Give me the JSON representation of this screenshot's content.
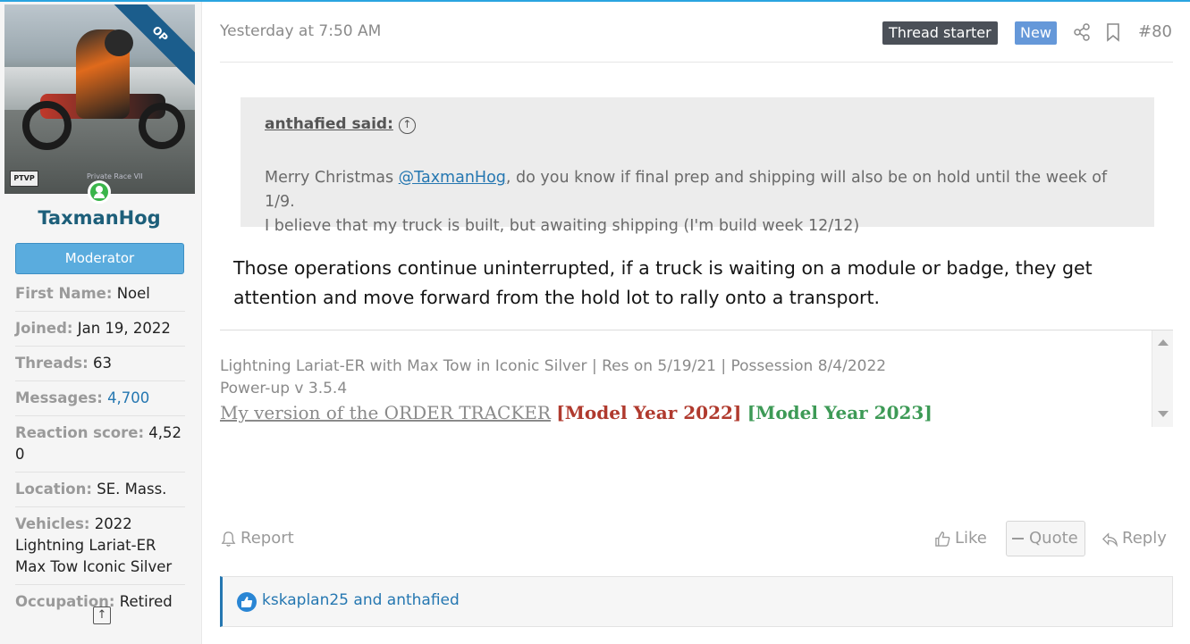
{
  "sidebar": {
    "op_label": "OP",
    "avatar_logo": "PTVP",
    "avatar_watermark": "Private Race VII",
    "username": "TaxmanHog",
    "role": "Moderator",
    "fields": [
      {
        "label": "First Name:",
        "value": "Noel"
      },
      {
        "label": "Joined:",
        "value": "Jan 19, 2022"
      },
      {
        "label": "Threads:",
        "value": "63"
      },
      {
        "label": "Messages:",
        "value": "4,700"
      },
      {
        "label": "Reaction score:",
        "value": "4,520"
      },
      {
        "label": "Location:",
        "value": "SE. Mass."
      },
      {
        "label": "Vehicles:",
        "value": "2022 Lightning Lariat-ER Max Tow Iconic Silver"
      },
      {
        "label": "Occupation:",
        "value": "Retired"
      }
    ],
    "scroll_top_icon": "arrow-up-icon"
  },
  "post": {
    "date": "Yesterday at 7:50 AM",
    "badge_starter": "Thread starter",
    "badge_new": "New",
    "post_number": "#80",
    "quote": {
      "author": "anthafied said:",
      "line1_before": "Merry Christmas ",
      "mention": "@TaxmanHog",
      "line1_after": ", do you know if final prep and shipping will also be on hold until the week of 1/9.",
      "line2": "I believe that my truck is built, but awaiting shipping (I'm build week 12/12)"
    },
    "message": "Those operations continue uninterrupted, if a truck is waiting on a module or badge, they get attention and move forward from the hold lot to rally onto a transport.",
    "signature": {
      "line1": "Lightning Lariat-ER with Max Tow in Iconic Silver | Res on 5/19/21 | Possession 8/4/2022",
      "line2": "Power-up v 3.5.4",
      "link1": "My version of the ORDER TRACKER",
      "link2": "[Model Year 2022]",
      "link3": "[Model Year 2023]"
    },
    "actions": {
      "report": "Report",
      "like": "Like",
      "quote": "Quote",
      "reply": "Reply"
    },
    "reactions": "kskaplan25 and anthafied"
  },
  "colors": {
    "accent": "#2577b1",
    "role_badge": "#5aacde",
    "thread_starter": "#4b5058",
    "new_badge": "#6598d9",
    "year2022": "#b03a2e",
    "year2023": "#3d9a56"
  }
}
